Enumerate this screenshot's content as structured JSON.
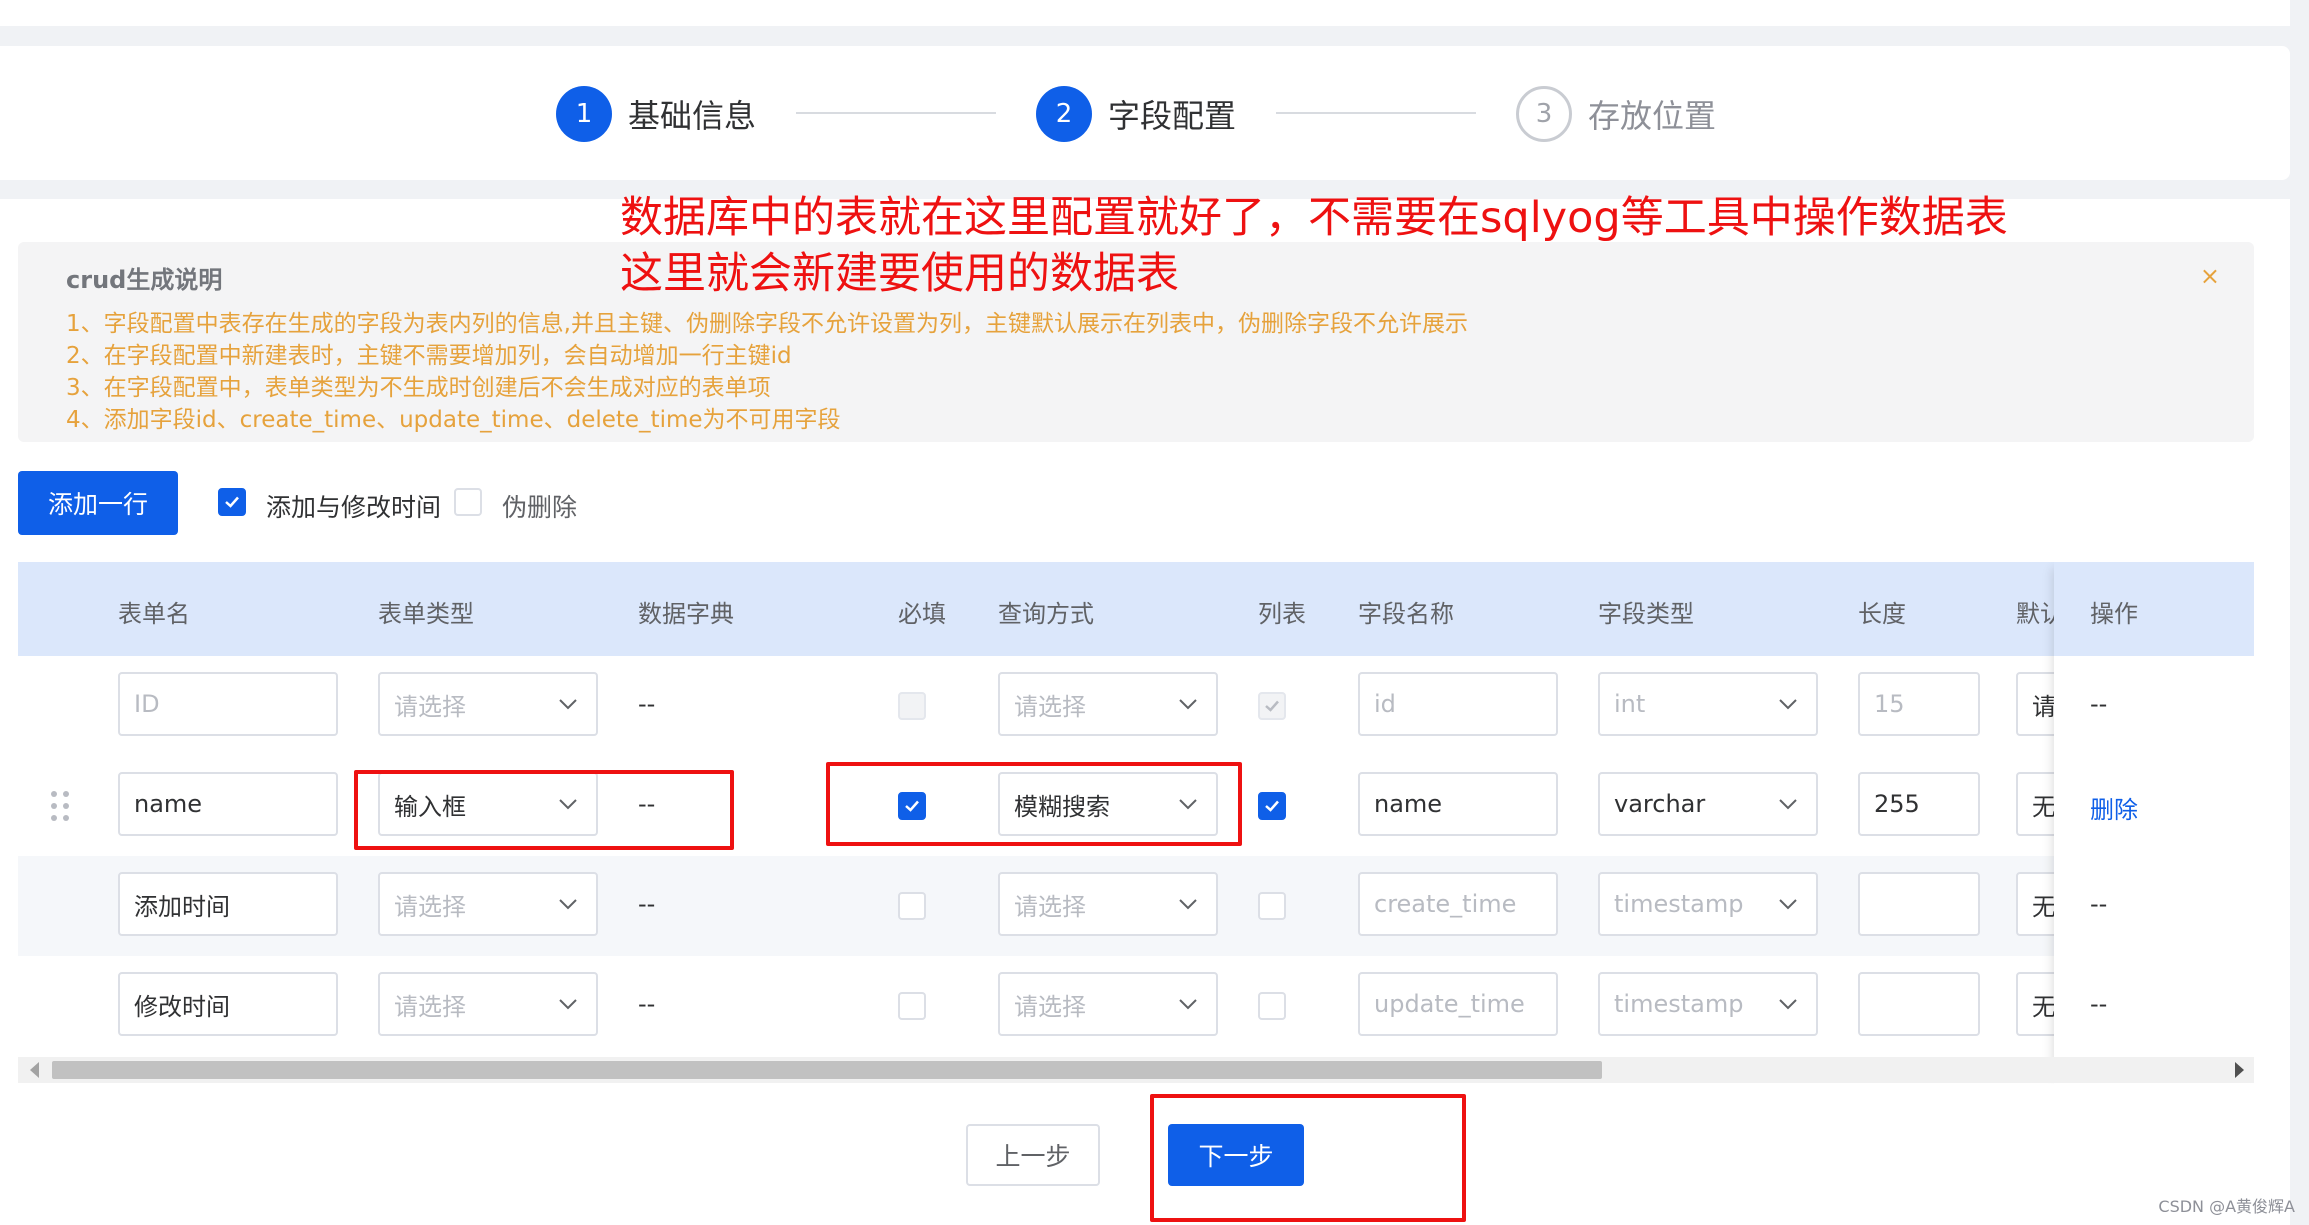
{
  "steps": [
    {
      "number": "1",
      "label": "基础信息"
    },
    {
      "number": "2",
      "label": "字段配置"
    },
    {
      "number": "3",
      "label": "存放位置"
    }
  ],
  "annotation": {
    "line1": "数据库中的表就在这里配置就好了，不需要在sqlyog等工具中操作数据表",
    "line2": "这里就会新建要使用的数据表",
    "color": "#ee1111"
  },
  "notice": {
    "title": "crud生成说明",
    "close": "×",
    "lines": [
      "1、字段配置中表存在生成的字段为表内列的信息,并且主键、伪删除字段不允许设置为列，主键默认展示在列表中，伪删除字段不允许展示",
      "2、在字段配置中新建表时，主键不需要增加列，会自动增加一行主键id",
      "3、在字段配置中，表单类型为不生成时创建后不会生成对应的表单项",
      "4、添加字段id、create_time、update_time、delete_time为不可用字段"
    ]
  },
  "toolbar": {
    "add_row": "添加一行",
    "timestamps_label": "添加与修改时间",
    "soft_delete_label": "伪删除"
  },
  "table": {
    "headers": [
      "表单名",
      "表单类型",
      "数据字典",
      "必填",
      "查询方式",
      "列表",
      "字段名称",
      "字段类型",
      "长度",
      "默认",
      "操作"
    ],
    "rows": [
      {
        "form_name": "ID",
        "form_type": "请选择",
        "dict": "--",
        "query": "请选择",
        "field_name": "id",
        "field_type": "int",
        "length": "15",
        "default": "请",
        "op": "--"
      },
      {
        "form_name": "name",
        "form_type": "输入框",
        "dict": "--",
        "query": "模糊搜索",
        "field_name": "name",
        "field_type": "varchar",
        "length": "255",
        "default": "无",
        "op": "删除"
      },
      {
        "form_name": "添加时间",
        "form_type": "请选择",
        "dict": "--",
        "query": "请选择",
        "field_name": "create_time",
        "field_type": "timestamp",
        "length": "",
        "default": "无",
        "op": "--"
      },
      {
        "form_name": "修改时间",
        "form_type": "请选择",
        "dict": "--",
        "query": "请选择",
        "field_name": "update_time",
        "field_type": "timestamp",
        "length": "",
        "default": "无",
        "op": "--"
      }
    ]
  },
  "footer": {
    "prev": "上一步",
    "next": "下一步"
  },
  "watermark": "CSDN @A黄俊辉A",
  "colors": {
    "primary": "#0f5fe8",
    "warning": "#e6a23c",
    "header_bg": "#dbe7fb"
  }
}
